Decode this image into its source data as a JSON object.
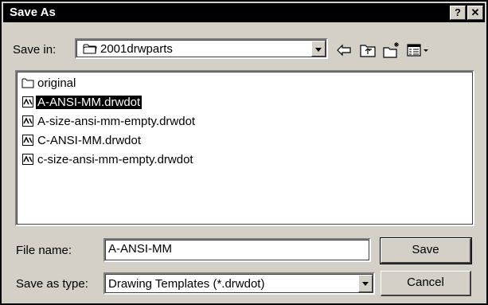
{
  "window": {
    "title": "Save As",
    "help_label": "?",
    "close_label": "✕"
  },
  "save_in": {
    "label": "Save in:",
    "value": "2001drwparts"
  },
  "toolbar": {
    "icons": [
      "back-arrow-icon",
      "up-one-level-icon",
      "create-new-folder-icon",
      "view-menu-icon"
    ]
  },
  "files": [
    {
      "name": "original",
      "type": "folder",
      "selected": false
    },
    {
      "name": "A-ANSI-MM.drwdot",
      "type": "drawing-template",
      "selected": true
    },
    {
      "name": "A-size-ansi-mm-empty.drwdot",
      "type": "drawing-template",
      "selected": false
    },
    {
      "name": "C-ANSI-MM.drwdot",
      "type": "drawing-template",
      "selected": false
    },
    {
      "name": "c-size-ansi-mm-empty.drwdot",
      "type": "drawing-template",
      "selected": false
    }
  ],
  "file_name": {
    "label": "File name:",
    "value": "A-ANSI-MM"
  },
  "save_as_type": {
    "label": "Save as type:",
    "value": "Drawing Templates (*.drwdot)"
  },
  "buttons": {
    "save": "Save",
    "cancel": "Cancel"
  }
}
